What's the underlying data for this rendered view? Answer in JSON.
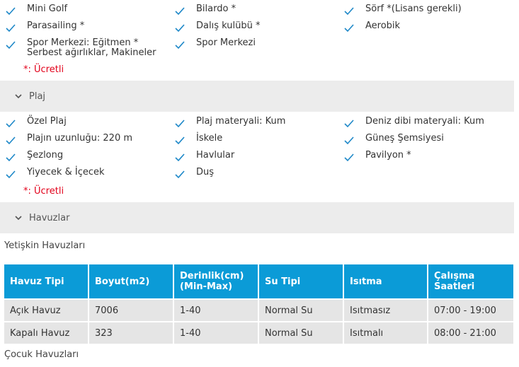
{
  "colors": {
    "check": "#1e88c8",
    "paid": "#e2001a",
    "table_header": "#0b9bd7"
  },
  "sports": {
    "col1": [
      "Mini Golf",
      "Parasailing *",
      "Spor Merkezi: Eğitmen * Serbest ağırlıklar, Makineler"
    ],
    "col2": [
      "Bilardo *",
      "Dalış kulübü *",
      "Spor Merkezi"
    ],
    "col3": [
      "Sörf *(Lisans gerekli)",
      "Aerobik"
    ],
    "paid_note": "*: Ücretli"
  },
  "beach": {
    "title": "Plaj",
    "col1": [
      "Özel Plaj",
      "Plajın uzunluğu: 220 m",
      "Şezlong",
      "Yiyecek & İçecek"
    ],
    "col2": [
      "Plaj materyali: Kum",
      "İskele",
      "Havlular",
      "Duş"
    ],
    "col3": [
      "Deniz dibi materyali: Kum",
      "Güneş Şemsiyesi",
      "Pavilyon *"
    ],
    "paid_note": "*: Ücretli"
  },
  "pools": {
    "title": "Havuzlar",
    "adult_title": "Yetişkin Havuzları",
    "child_title": "Çocuk Havuzları",
    "headers": [
      "Havuz Tipi",
      "Boyut(m2)",
      "Derinlik(cm)\n(Min-Max)",
      "Su Tipi",
      "Isıtma",
      "Çalışma Saatleri"
    ],
    "rows": [
      [
        "Açık Havuz",
        "7006",
        "1-40",
        "Normal Su",
        "Isıtmasız",
        "07:00 - 19:00"
      ],
      [
        "Kapalı Havuz",
        "323",
        "1-40",
        "Normal Su",
        "Isıtmalı",
        "08:00 - 21:00"
      ]
    ]
  }
}
